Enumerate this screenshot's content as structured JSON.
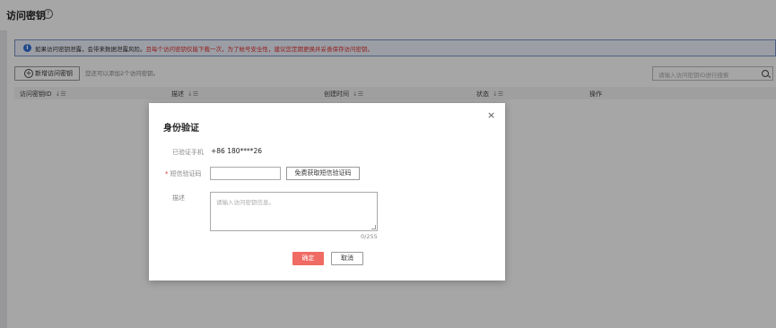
{
  "page": {
    "title": "访问密钥",
    "help_icon": "?",
    "notice": {
      "normal_text": "如果访问密钥泄露，会带来数据泄露风险。",
      "warning_text": "且每个访问密钥仅能下载一次，为了帐号安全性，建议您定期更换并妥善保存访问密钥。",
      "warning_color": "#e0302f"
    },
    "new_key_button": "新增访问密钥",
    "hint": "您还可以添加2个访问密钥。",
    "search_placeholder": "请输入访问密钥ID进行搜索",
    "table_columns": [
      "访问密钥ID",
      "描述",
      "创建时间",
      "状态",
      "操作"
    ],
    "sort_glyph": "↓☰"
  },
  "modal": {
    "title": "身份验证",
    "close_glyph": "×",
    "verified_phone_label": "已验证手机",
    "verified_phone_value": "+86 180****26",
    "sms_code_label": "短信验证码",
    "required_mark": "*",
    "get_code_button": "免费获取短信验证码",
    "description_label": "描述",
    "description_placeholder": "请输入访问密钥信息。",
    "char_counter": "0/255",
    "confirm_button": "确定",
    "cancel_button": "取消",
    "accent_color": "#ef6b63"
  }
}
